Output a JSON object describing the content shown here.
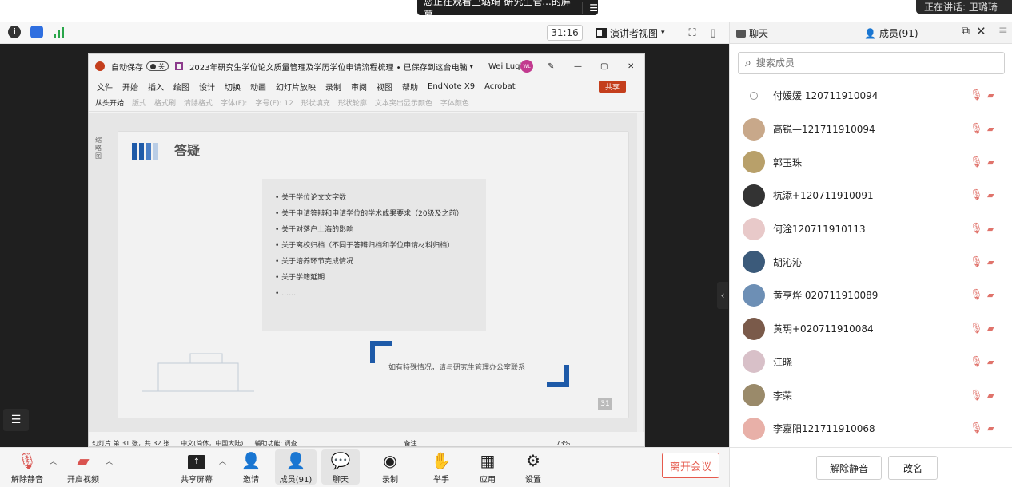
{
  "notice": {
    "text": "您正在观看卫璐琦-研究生管...的屏幕",
    "menu_icon": "☰"
  },
  "speaker": {
    "text": "正在讲话: 卫璐琦"
  },
  "topbar": {
    "timer": "31:16",
    "view_mode": "演讲者视图"
  },
  "right_header": {
    "chat_tab": "聊天",
    "members_tab": "成员(91)"
  },
  "ppt": {
    "autosave": "自动保存",
    "autosave_state": "关",
    "doc_title": "2023年研究生学位论文质量管理及学历学位申请流程梳理 • 已保存到这台电脑",
    "user": "Wei Luqi",
    "user_initials": "WL",
    "share_btn": "共享",
    "menu": [
      "文件",
      "开始",
      "插入",
      "绘图",
      "设计",
      "切换",
      "动画",
      "幻灯片放映",
      "录制",
      "审阅",
      "视图",
      "帮助",
      "EndNote X9",
      "Acrobat"
    ],
    "ribbon": [
      "从头开始",
      "版式",
      "格式刷",
      "清除格式",
      "字体(F):",
      "字号(F): 12",
      "形状填充",
      "形状轮廓",
      "文本突出显示颜色",
      "字体颜色"
    ],
    "thumb_label": "缩略图",
    "slide": {
      "title": "答疑",
      "bullets": [
        "关于学位论文文字数",
        "关于申请答辩和申请学位的学术成果要求（20级及之前）",
        "关于对落户上海的影响",
        "关于离校归档（不同于答辩归档和学位申请材料归档）",
        "关于培养环节完成情况",
        "关于学籍延期",
        "……"
      ],
      "contact": "如有特殊情况，请与研究生管理办公室联系",
      "number": "31",
      "accent_color": "#1e5aa8"
    },
    "status": {
      "slide_info": "幻灯片 第 31 张，共 32 张",
      "language": "中文(简体，中国大陆)",
      "accessibility": "辅助功能: 调查",
      "notes": "备注",
      "zoom": "73%"
    }
  },
  "bottombar": {
    "mute": "解除静音",
    "video": "开启视频",
    "share": "共享屏幕",
    "invite": "邀请",
    "members": "成员(91)",
    "chat": "聊天",
    "record": "录制",
    "raise": "举手",
    "apps": "应用",
    "settings": "设置",
    "leave": "离开会议"
  },
  "rpanel": {
    "search_placeholder": "搜索成员",
    "members": [
      {
        "name": "付媛媛 120711910094",
        "color": "#ffffff"
      },
      {
        "name": "高锐—121711910094",
        "color": "#c8a88a"
      },
      {
        "name": "郭玉珠",
        "color": "#b8a06a"
      },
      {
        "name": "杭添+120711910091",
        "color": "#333333"
      },
      {
        "name": "何淦120711910113",
        "color": "#e8c9c9"
      },
      {
        "name": "胡沁沁",
        "color": "#3b5a7a"
      },
      {
        "name": "黄亨烨 020711910089",
        "color": "#6d8fb5"
      },
      {
        "name": "黄玥+020711910084",
        "color": "#7a5a4a"
      },
      {
        "name": "江晓",
        "color": "#d8c0c8"
      },
      {
        "name": "李荣",
        "color": "#9a8a6a"
      },
      {
        "name": "李嘉阳121711910068",
        "color": "#e8b0a8"
      }
    ],
    "unmute_btn": "解除静音",
    "rename_btn": "改名"
  }
}
